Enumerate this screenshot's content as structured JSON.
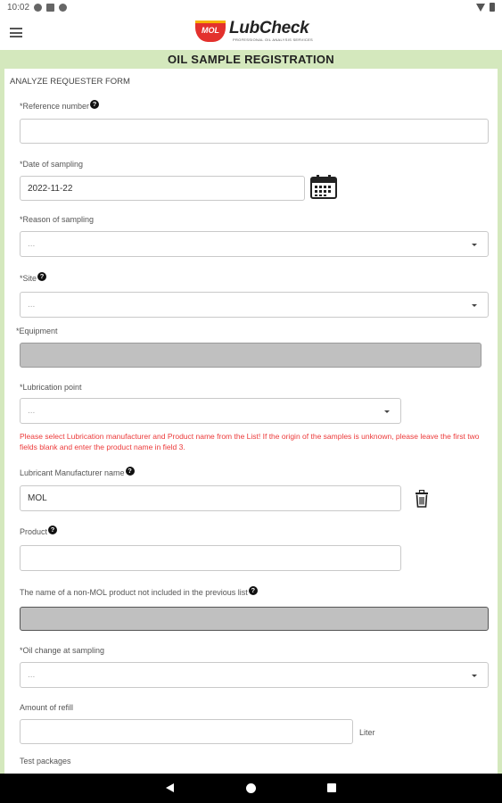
{
  "status_bar": {
    "time": "10:02",
    "icons_left": [
      "a-icon",
      "sim-icon",
      "sync-icon"
    ],
    "icons_right": [
      "wifi-icon",
      "battery-icon"
    ]
  },
  "app_bar": {
    "menu_icon": "hamburger-icon",
    "logo_badge": "MOL",
    "logo_name": "LubCheck",
    "logo_tagline": "PROFESSIONAL OIL ANALYSIS SERVICES"
  },
  "page_title": "OIL SAMPLE REGISTRATION",
  "form": {
    "section_title": "ANALYZE REQUESTER FORM",
    "reference_number": {
      "label": "*Reference number",
      "value": ""
    },
    "date_of_sampling": {
      "label": "*Date of sampling",
      "value": "2022-11-22"
    },
    "reason_of_sampling": {
      "label": "*Reason of sampling",
      "value": "..."
    },
    "site": {
      "label": "*Site",
      "value": "..."
    },
    "equipment": {
      "label": "*Equipment",
      "value": ""
    },
    "lubrication_point": {
      "label": "*Lubrication point",
      "value": "..."
    },
    "error_message": "Please select Lubrication manufacturer and Product name from the List! If the origin of the samples is unknown, please leave the first two fields blank and enter the product name in field 3.",
    "lubricant_manufacturer": {
      "label": "Lubricant Manufacturer name",
      "value": "MOL"
    },
    "product": {
      "label": "Product",
      "value": ""
    },
    "non_mol_product": {
      "label": "The name of a non-MOL product not included in the previous list",
      "value": ""
    },
    "oil_change": {
      "label": "*Oil change at sampling",
      "value": "..."
    },
    "amount_of_refill": {
      "label": "Amount of refill",
      "value": "",
      "unit": "Liter"
    },
    "test_packages": {
      "label": "Test packages"
    },
    "help_symbol": "?"
  },
  "colors": {
    "title_band": "#d4e8bd",
    "error_text": "#ec3a3a",
    "disabled_field": "#c0c0c0",
    "logo_red": "#e3312d"
  }
}
